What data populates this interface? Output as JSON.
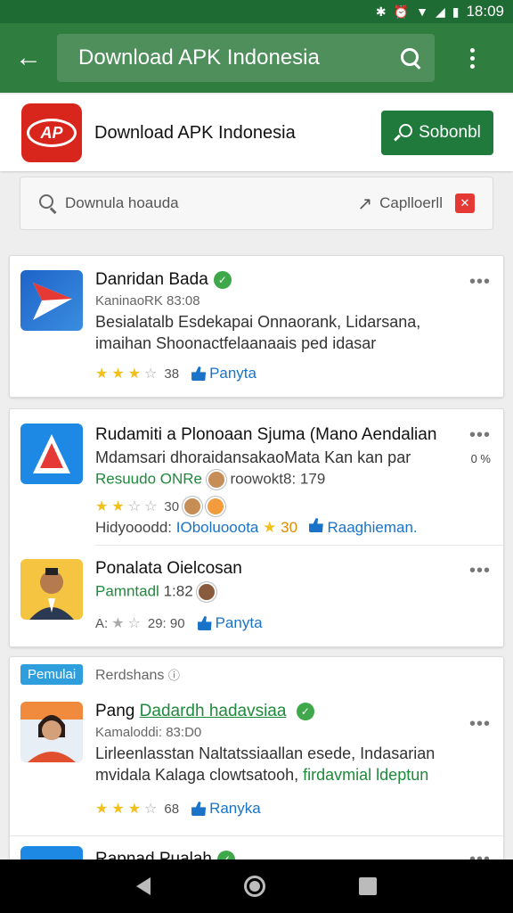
{
  "status_bar": {
    "icons": [
      "bluetooth-icon",
      "alarm-icon",
      "wifi-icon",
      "signal-icon",
      "battery-icon"
    ],
    "time": "18:09"
  },
  "app_bar": {
    "search_text": "Download APK Indonesia"
  },
  "header": {
    "logo_text": "AP",
    "title": "Download APK Indonesia",
    "search_button": "Sobonbl"
  },
  "filter": {
    "placeholder": "Downula hoauda",
    "sort_label": "Caplloerll",
    "close": "✕"
  },
  "items": [
    {
      "title": "Danridan Bada",
      "subtitle": "KaninaoRK 83:08",
      "desc1": "Besialatalb Esdekapai Onnaorank, Lidarsana,",
      "desc2": "imaihan Shoonactfelaanaais ped idasar",
      "rating": "38",
      "like_label": "Panyta"
    },
    {
      "title": "Rudamiti a Plonoaan Sjuma (Mano Aendalian",
      "line2": "Mdamsari dhoraidansakaoMata Kan kan par",
      "line2_side": "0 %",
      "green_label": "Resuudo ONRe",
      "meta": "roowokt8: 179",
      "rating": "30",
      "line4_left": "Hidyooodd:",
      "line4_link": "IOboluooota",
      "line4_num": "30",
      "line4_right": "Raaghieman."
    },
    {
      "title": "Ponalata Oielcosan",
      "green_label": "Pamntadl",
      "meta": "1:82",
      "rating_prefix": "A:",
      "rating": "29: 90",
      "like_label": "Panyta"
    },
    {
      "tag": "Pemulai",
      "tag_label": "Rerdshans",
      "title": "Pang",
      "title_green": "Dadardh hadavsiaa",
      "subtitle": "Kamaloddi: 83:D0",
      "desc1": "Lirleenlasstan Naltatssiaallan esede, Indasarian",
      "desc2": "mvidala Kalaga clowtsatooh,",
      "desc2_green": "firdavmial ldeptun",
      "rating": "68",
      "like_label": "Ranyka"
    },
    {
      "title": "Rapnad Pualah"
    }
  ]
}
